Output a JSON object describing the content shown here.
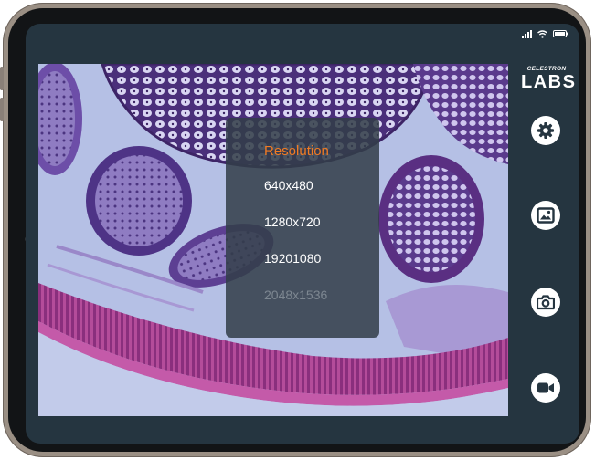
{
  "status_bar": {
    "signal_icon": "cellular-signal-icon",
    "wifi_icon": "wifi-icon",
    "battery_icon": "battery-icon"
  },
  "brand": {
    "top": "CELESTRON",
    "main": "LABS"
  },
  "resolution_menu": {
    "title": "Resolution",
    "options": [
      {
        "label": "640x480",
        "enabled": true
      },
      {
        "label": "1280x720",
        "enabled": true
      },
      {
        "label": "19201080",
        "enabled": true
      },
      {
        "label": "2048x1536",
        "enabled": false
      }
    ]
  },
  "side_buttons": [
    {
      "icon": "gear-icon"
    },
    {
      "icon": "image-gallery-icon"
    },
    {
      "icon": "camera-icon"
    },
    {
      "icon": "video-camera-icon"
    }
  ],
  "colors": {
    "accent": "#f07b24",
    "screen_bg": "#253540",
    "disabled_text": "#7d8791"
  }
}
